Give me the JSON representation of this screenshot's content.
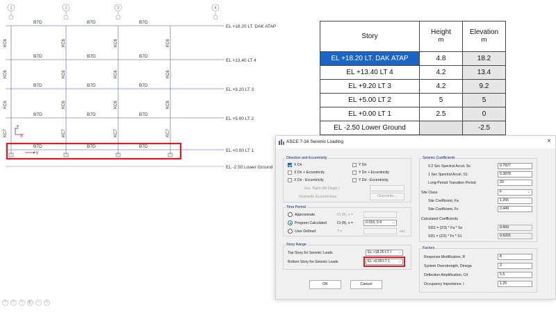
{
  "drawing": {
    "axes": [
      {
        "label": "1"
      },
      {
        "label": "2"
      },
      {
        "label": "3"
      },
      {
        "label": "4"
      }
    ],
    "beam_label": "B7D",
    "column_labels": {
      "upper": "KC6",
      "lower": "KC7"
    },
    "story_labels": [
      "EL +18.20 LT. DAK ATAP",
      "EL +13.40 LT 4",
      "EL +9.20 LT 3",
      "EL +5.00 LT 2",
      "EL +0.00 LT 1",
      "EL -2.50 Lower Ground"
    ],
    "local_axes": {
      "x": "X",
      "y": "Y",
      "z": "Z"
    },
    "colors": {
      "grid": "#7b8bb5",
      "highlight": "#e3181f",
      "axis_x": "#e3181f",
      "axis_z": "#1a3fd0"
    }
  },
  "story_table": {
    "headers": {
      "story": "Story",
      "height": "Height",
      "height_unit": "m",
      "elevation": "Elevation",
      "elevation_unit": "m"
    },
    "rows": [
      {
        "story": "EL +18.20 LT. DAK ATAP",
        "height": "4.8",
        "elevation": "18.2"
      },
      {
        "story": "EL +13.40 LT 4",
        "height": "4.2",
        "elevation": "13.4"
      },
      {
        "story": "EL +9.20 LT 3",
        "height": "4.2",
        "elevation": "9.2"
      },
      {
        "story": "EL +5.00 LT 2",
        "height": "5",
        "elevation": "5"
      },
      {
        "story": "EL +0.00 LT 1",
        "height": "2.5",
        "elevation": "0"
      },
      {
        "story": "EL -2.50 Lower Ground",
        "height": "",
        "elevation": "-2.5"
      }
    ],
    "selected_color": "#1a63c7"
  },
  "dialog": {
    "title": "ASCE 7-16 Seismic Loading",
    "close": "×",
    "direction": {
      "title": "Direction and Eccentricity",
      "x_dir": "X Dir",
      "y_dir": "Y Dir",
      "x_dir_plus": "X Dir + Eccentricity",
      "y_dir_plus": "Y Dir + Eccentricity",
      "x_dir_minus": "X Dir - Eccentricity",
      "y_dir_minus": "Y Dir - Eccentricity",
      "ecc_ratio": "Ecc. Ratio (All Diaph.)",
      "override": "Overwrite Eccentricities",
      "override_button": "Overwrite..."
    },
    "time_period": {
      "title": "Time Period",
      "approximate": "Approximate",
      "ct_approx": "Ct (ft), x =",
      "program_calculated": "Program Calculated",
      "ct_program": "Ct (ft), x =",
      "ct_value": "0.016;  0.9",
      "user_defined": "User Defined",
      "t_label": "T =",
      "t_unit": "sec"
    },
    "story_range": {
      "title": "Story Range",
      "top_label": "Top Story for Seismic Loads",
      "top_value": "EL +18.20 LT. I",
      "bottom_label": "Bottom Story for Seismic Loads",
      "bottom_value": "EL +0.00 LT 1"
    },
    "buttons": {
      "ok": "OK",
      "cancel": "Cancel"
    },
    "seismic": {
      "title": "Seismic Coefficients",
      "ss_label": "0.2 Sec Spectral Accel, Ss",
      "ss_value": "0.7927",
      "s1_label": "1 Sec Spectral Accel, S1",
      "s1_value": "0.3878",
      "tl_label": "Long-Period Transition Period",
      "tl_value": "20",
      "site_class_label": "Site Class",
      "site_class_value": "F",
      "fa_label": "Site Coefficient, Fa",
      "fa_value": "1.266",
      "fv_label": "Site Coefficient, Fv",
      "fv_value": "2.449",
      "calc_label": "Calculated Coefficients",
      "sds_label": "SDS = (2/3) * Fa * Ss",
      "sds_value": "0.669",
      "sd1_label": "SD1 = (2/3) * Fv * S1",
      "sd1_value": "0.6331"
    },
    "factors": {
      "title": "Factors",
      "r_label": "Response Modification, R",
      "r_value": "8",
      "omega_label": "System Overstrength, Omega",
      "omega_value": "3",
      "cd_label": "Deflection Amplification, Cd",
      "cd_value": "5.5",
      "ie_label": "Occupancy Importance, I",
      "ie_value": "1.25"
    }
  },
  "toolbar": {
    "icons": [
      "⟲",
      "⟳",
      "✎",
      "◧",
      "⌕",
      "⊖"
    ]
  }
}
